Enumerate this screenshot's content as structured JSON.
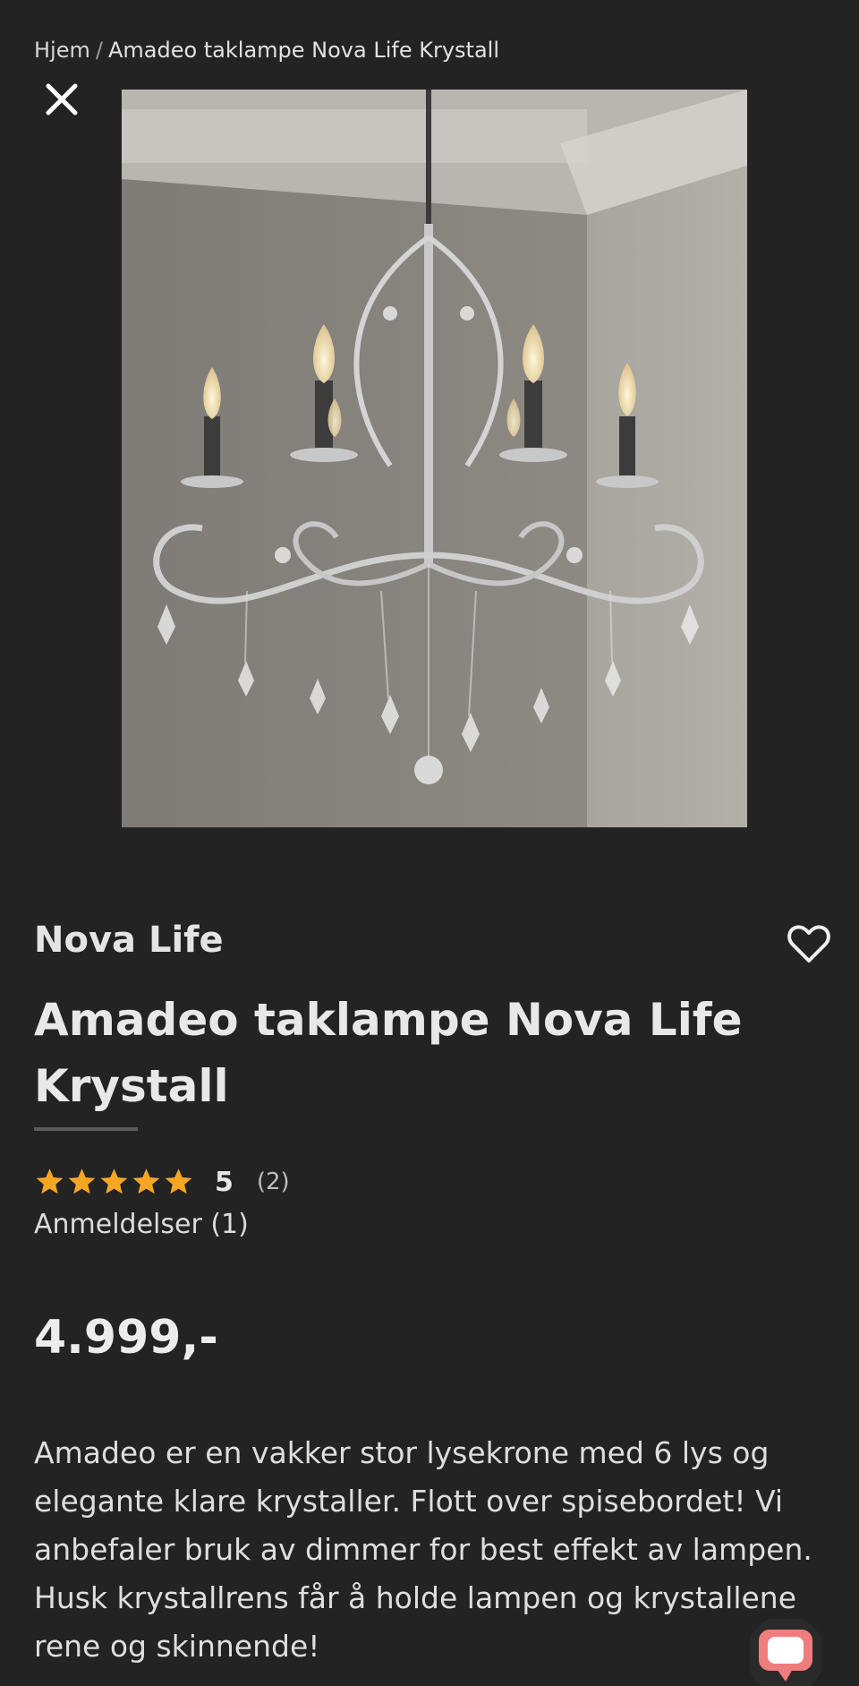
{
  "breadcrumb": {
    "home": "Hjem",
    "separator": "/",
    "current": "Amadeo taklampe Nova Life Krystall"
  },
  "icons": {
    "close": "close-icon",
    "favorite": "heart-outline-icon",
    "star": "star-icon",
    "chat": "chat-bubble-icon"
  },
  "colors": {
    "background": "#232323",
    "star": "#f6a623",
    "chat": "#ef7d7d"
  },
  "product": {
    "image_alt": "Amadeo taklampe Nova Life Krystall",
    "brand": "Nova Life",
    "title": "Amadeo taklampe Nova Life Krystall",
    "rating": {
      "stars": 5,
      "score": "5",
      "count": "(2)"
    },
    "reviews_link": "Anmeldelser (1)",
    "price": "4.999,-",
    "description": "Amadeo er en vakker stor lysekrone med 6 lys og elegante klare krystaller. Flott over spisebordet! Vi anbefaler bruk av dimmer for best effekt av lampen. Husk krystallrens får å holde lampen og krystallene rene og skinnende!"
  }
}
